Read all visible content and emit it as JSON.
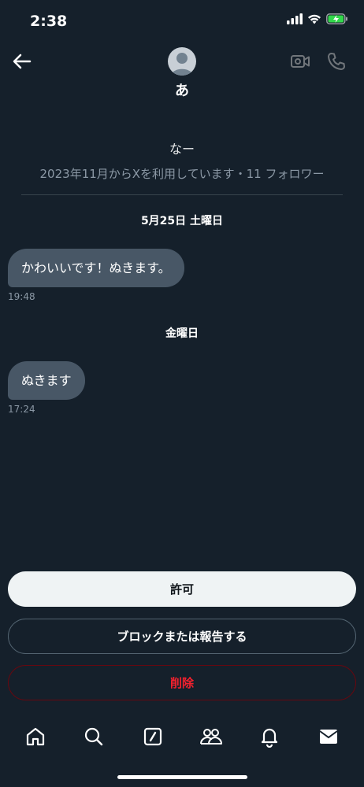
{
  "status": {
    "time": "2:38"
  },
  "header": {
    "name": "あ"
  },
  "profile": {
    "bio": "なー",
    "joined": "2023年11月からXを利用しています・11 フォロワー"
  },
  "messages": [
    {
      "date": "5月25日 土曜日",
      "text": "かわいいです！ぬきます。",
      "time": "19:48"
    },
    {
      "date": "金曜日",
      "text": "ぬきます",
      "time": "17:24"
    }
  ],
  "actions": {
    "allow": "許可",
    "block_report": "ブロックまたは報告する",
    "delete": "削除"
  },
  "colors": {
    "background": "#15202b",
    "bubble": "#485766",
    "danger": "#f4212e",
    "allow_button": "#eff3f4"
  },
  "nav": {
    "items": [
      "home-icon",
      "search-icon",
      "compose-icon",
      "communities-icon",
      "notifications-icon",
      "messages-icon"
    ]
  }
}
